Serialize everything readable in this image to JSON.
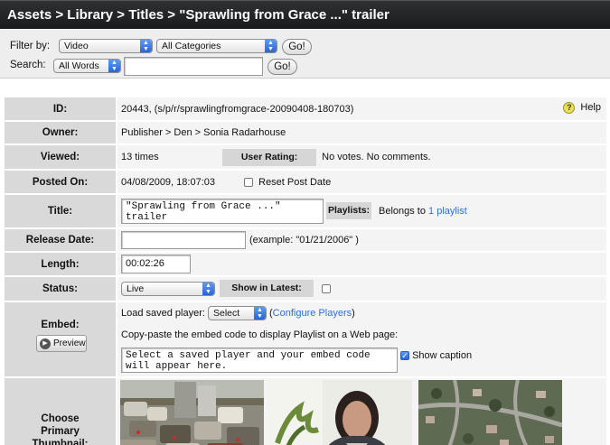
{
  "header": {
    "title": "Assets > Library > Titles > \"Sprawling from Grace ...\" trailer"
  },
  "filter": {
    "filter_label": "Filter by:",
    "type_value": "Video",
    "category_value": "All Categories",
    "go_label": "Go!",
    "search_label": "Search:",
    "search_mode_value": "All Words",
    "search_value": "",
    "search_go_label": "Go!"
  },
  "details": {
    "id_label": "ID:",
    "id_value": "20443, (s/p/r/sprawlingfromgrace-20090408-180703)",
    "help_label": "Help",
    "owner_label": "Owner:",
    "owner_value": "Publisher > Den > Sonia Radarhouse",
    "viewed_label": "Viewed:",
    "viewed_value": "13 times",
    "rating_label": "User Rating:",
    "rating_value": "No votes. No comments.",
    "posted_label": "Posted On:",
    "posted_value": "04/08/2009, 18:07:03",
    "reset_post_date_label": "Reset Post Date",
    "title_label": "Title:",
    "title_value": "\"Sprawling from Grace ...\"\ntrailer",
    "playlists_label": "Playlists:",
    "belongs_text": "Belongs to",
    "playlist_link": "1 playlist",
    "release_label": "Release Date:",
    "release_value": "",
    "release_example": "(example: \"01/21/2006\" )",
    "length_label": "Length:",
    "length_value": "00:02:26",
    "status_label": "Status:",
    "status_value": "Live",
    "show_latest_label": "Show in Latest:",
    "embed_label": "Embed:",
    "preview_label": "Preview",
    "load_player_label": "Load saved player:",
    "player_select_value": "Select",
    "configure_open": "(",
    "configure_link": "Configure Players",
    "configure_close": ")",
    "embed_instructions": "Copy-paste the embed code to display Playlist on a Web page:",
    "embed_code_value": "Select a saved player and your embed code\nwill appear here.",
    "show_caption_label": "Show caption",
    "thumbnail_label": "Choose Primary Thumbnail:"
  },
  "colors": {
    "header_bg": "#1a1b1d",
    "label_bg": "#d9d9d9",
    "value_bg": "#f4f4f4",
    "link": "#2f6fd6",
    "select_arrow": "#2765d6"
  },
  "icons": {
    "help": "question-mark-icon",
    "preview": "play-icon",
    "select_arrow": "updown-arrow-icon"
  }
}
